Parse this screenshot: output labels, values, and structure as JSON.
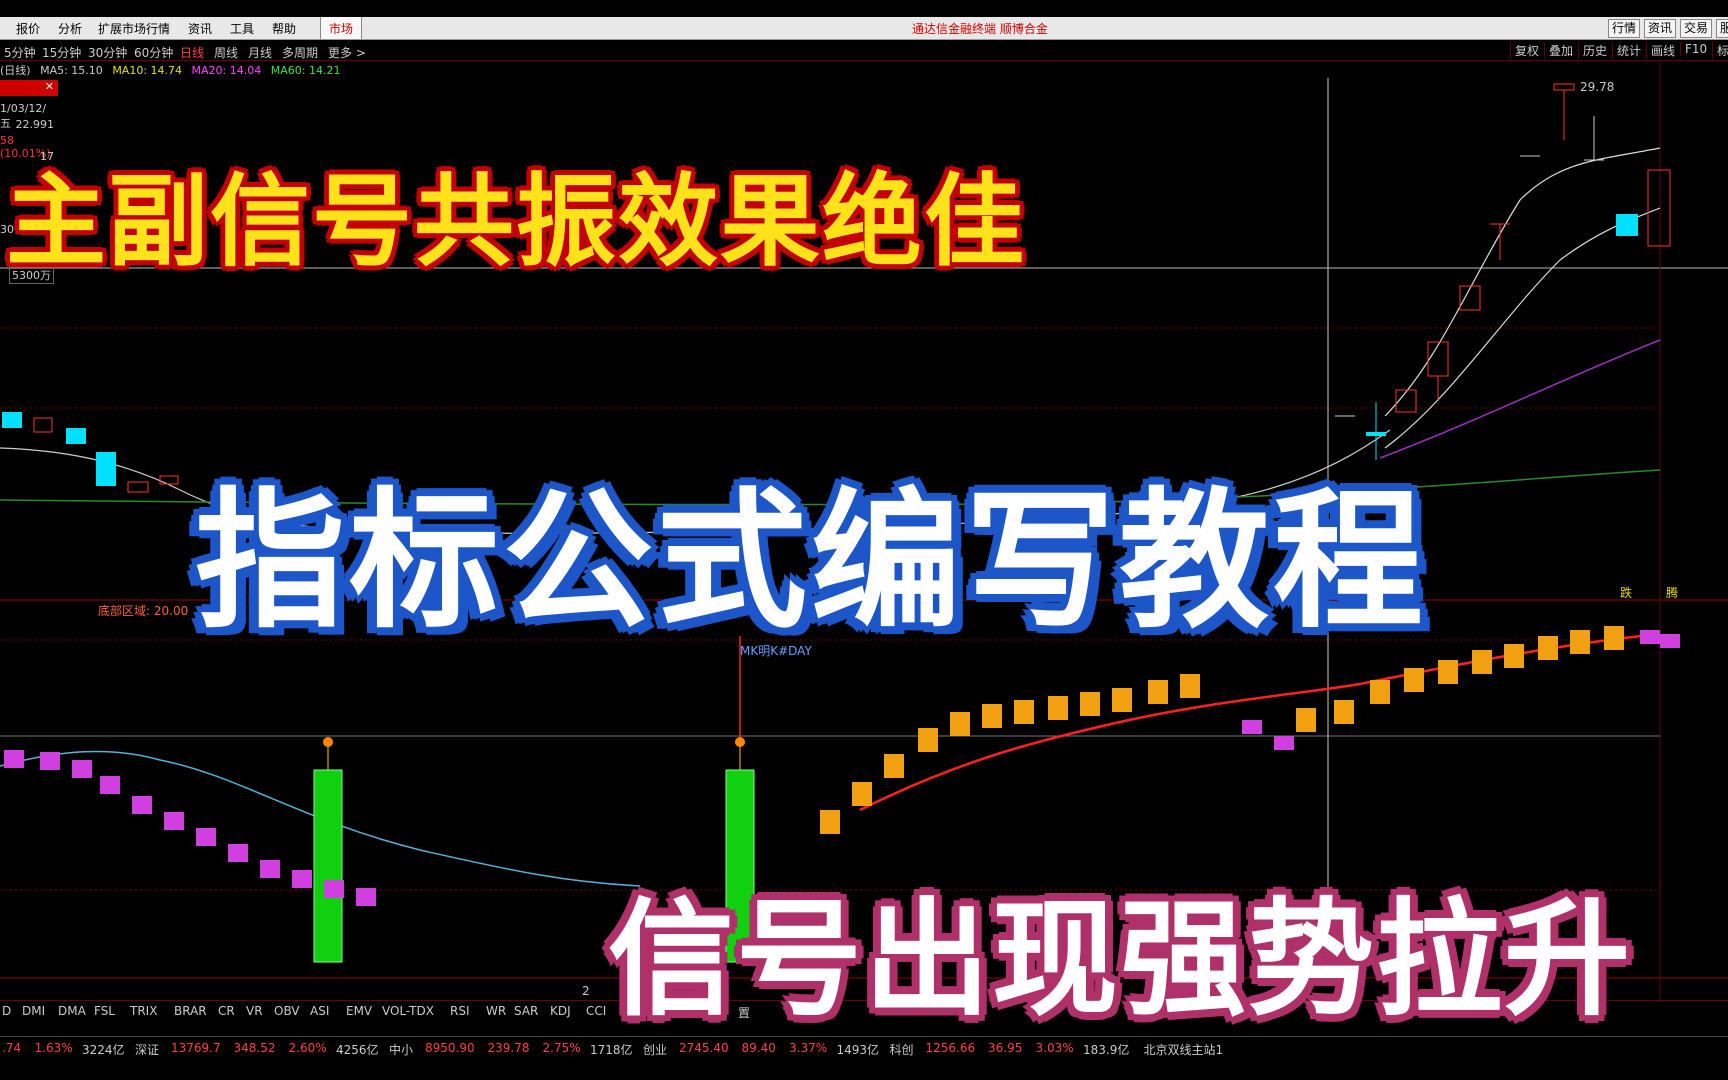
{
  "menu": {
    "items": [
      "报价",
      "分析",
      "扩展市场行情",
      "资讯",
      "工具",
      "帮助"
    ],
    "market_tab": "市场",
    "title": "通达信金融终端  顺博合金",
    "right_buttons": [
      "行情",
      "资讯",
      "交易",
      "服"
    ]
  },
  "periods": {
    "items": [
      "5分钟",
      "15分钟",
      "30分钟",
      "60分钟",
      "日线",
      "周线",
      "月线",
      "多周期",
      "更多 >"
    ],
    "tools": [
      "复权",
      "叠加",
      "历史",
      "统计",
      "画线",
      "F10",
      "标"
    ]
  },
  "ma": {
    "period_label": "(日线)",
    "ma5": "MA5: 15.10",
    "ma10": "MA10: 14.74",
    "ma20": "MA20: 14.04",
    "ma60": "MA60: 14.21"
  },
  "infobox": {
    "date": "1/03/12/五",
    "price": "22.991",
    "change": "58 (10.01%)",
    "num": "17",
    "num2": "30",
    "volume": "5300万"
  },
  "labels": {
    "high_price": "29.78",
    "bottom_zone": "底部区域: 20.00",
    "indicator_name": "MK明K#DAY",
    "fall": "跌",
    "rise": "腾",
    "sub_marker": "2"
  },
  "overlay": {
    "title1": "主副信号共振效果绝佳",
    "title2": "指标公式编写教程",
    "title3": "信号出现强势拉升"
  },
  "indicators": [
    "D",
    "DMI",
    "DMA",
    "FSL",
    "TRIX",
    "BRAR",
    "CR",
    "VR",
    "OBV",
    "ASI",
    "EMV",
    "VOL-TDX",
    "RSI",
    "WR",
    "SAR",
    "KDJ",
    "CCI",
    "ROC",
    "MTM",
    "BOLL",
    "置"
  ],
  "status": {
    "items": [
      {
        "t": ".74",
        "c": "#ff4040"
      },
      {
        "t": "1.63%",
        "c": "#ff4040"
      },
      {
        "t": "3224亿",
        "c": "#ccc"
      },
      {
        "t": "深证",
        "c": "#ccc"
      },
      {
        "t": "13769.7",
        "c": "#ff4040"
      },
      {
        "t": "348.52",
        "c": "#ff4040"
      },
      {
        "t": "2.60%",
        "c": "#ff4040"
      },
      {
        "t": "4256亿",
        "c": "#ccc"
      },
      {
        "t": "中小",
        "c": "#ccc"
      },
      {
        "t": "8950.90",
        "c": "#ff4040"
      },
      {
        "t": "239.78",
        "c": "#ff4040"
      },
      {
        "t": "2.75%",
        "c": "#ff4040"
      },
      {
        "t": "1718亿",
        "c": "#ccc"
      },
      {
        "t": "创业",
        "c": "#ccc"
      },
      {
        "t": "2745.40",
        "c": "#ff4040"
      },
      {
        "t": "89.40",
        "c": "#ff4040"
      },
      {
        "t": "3.37%",
        "c": "#ff4040"
      },
      {
        "t": "1493亿",
        "c": "#ccc"
      },
      {
        "t": "科创",
        "c": "#ccc"
      },
      {
        "t": "1256.66",
        "c": "#ff4040"
      },
      {
        "t": "36.95",
        "c": "#ff4040"
      },
      {
        "t": "3.03%",
        "c": "#ff4040"
      },
      {
        "t": "183.9亿",
        "c": "#ccc"
      },
      {
        "t": "北京双线主站1",
        "c": "#ccc"
      }
    ]
  },
  "colors": {
    "up": "#ff3030",
    "down": "#00e0ff",
    "accent_red": "#d00000"
  }
}
